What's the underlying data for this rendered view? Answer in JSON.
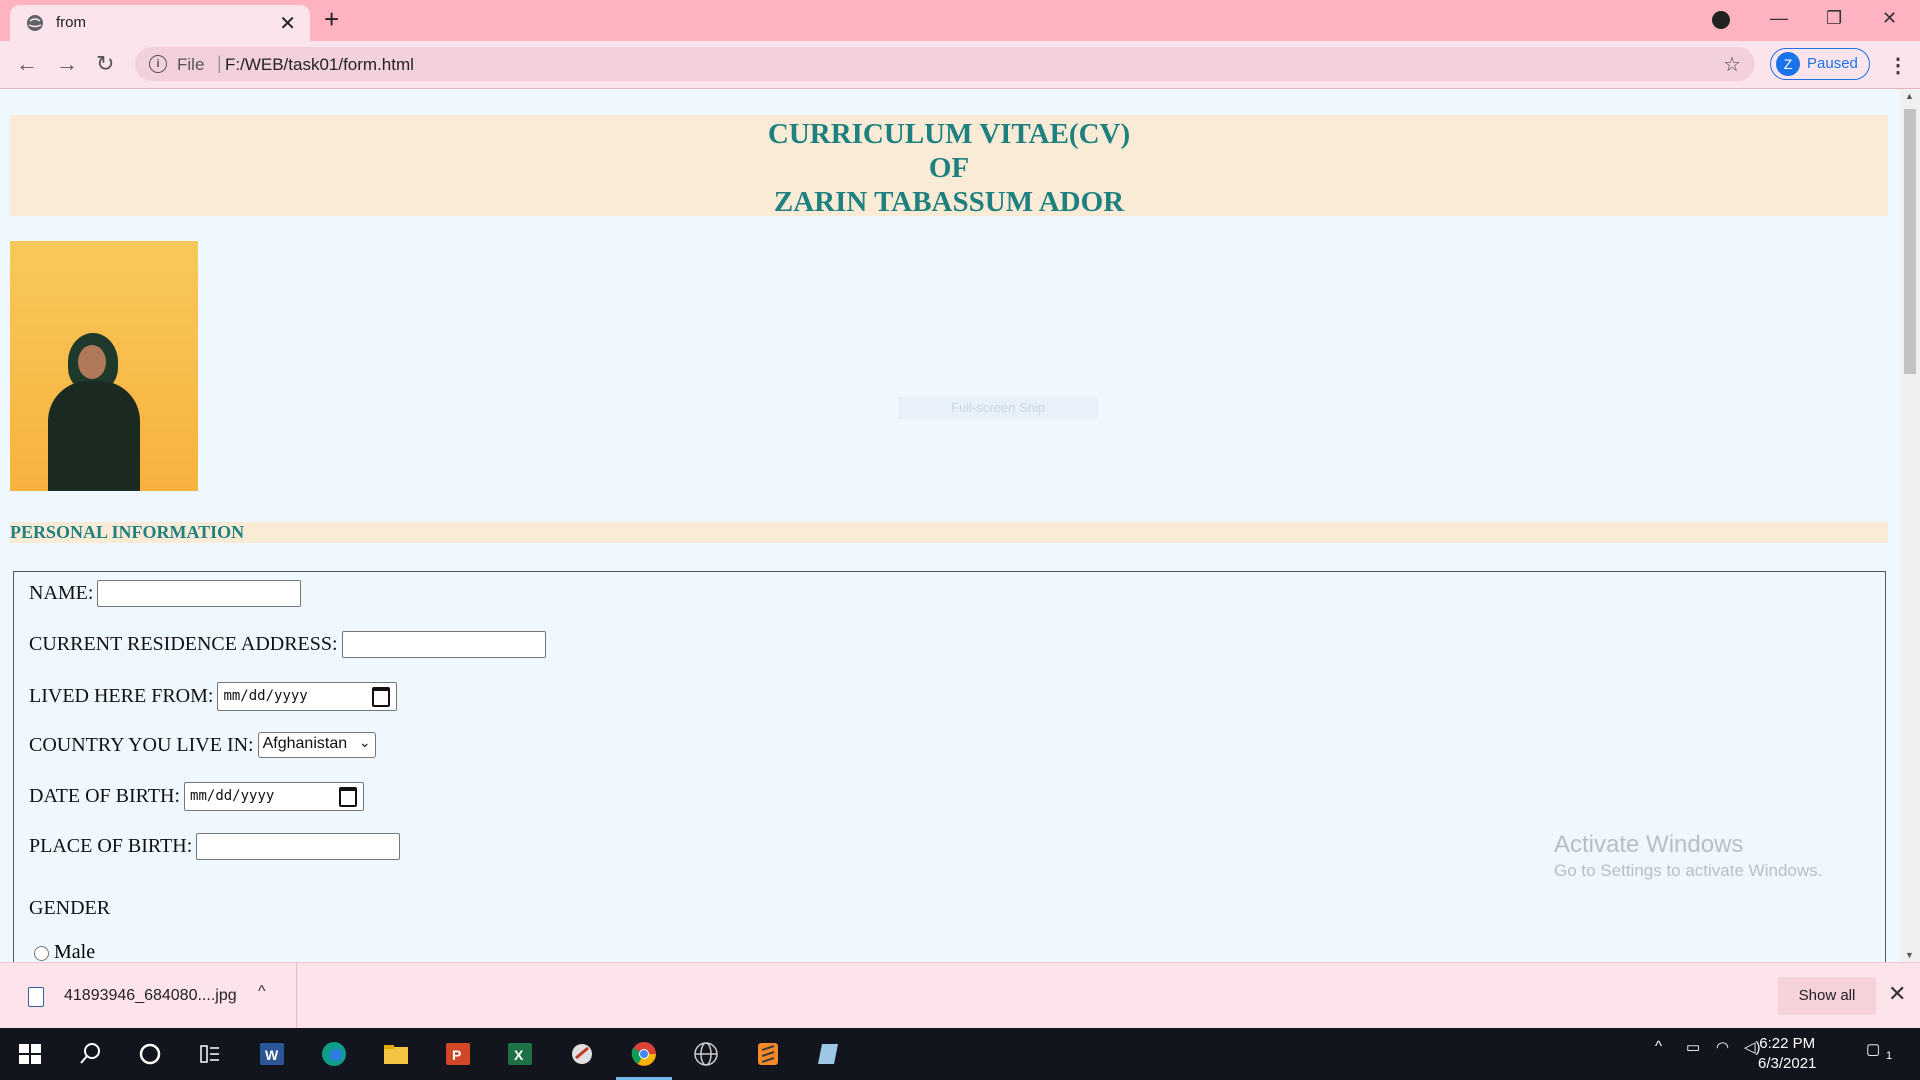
{
  "browser": {
    "tab_title": "from",
    "new_tab": "+",
    "address_file": "File",
    "address_sep": "|",
    "address_url": "F:/WEB/task01/form.html",
    "profile_initial": "Z",
    "profile_status": "Paused"
  },
  "page": {
    "header_line1": "CURRICULUM VITAE(CV)",
    "header_line2": "OF",
    "header_line3": "ZARIN TABASSUM ADOR",
    "snip_text": "Full-screen Snip",
    "section_personal": "PERSONAL INFORMATION",
    "fields": {
      "name_label": "NAME:",
      "address_label": "CURRENT RESIDENCE ADDRESS:",
      "lived_label": "LIVED HERE FROM:",
      "lived_placeholder": "mm/dd/yyyy",
      "country_label": "COUNTRY YOU LIVE IN:",
      "country_value": "Afghanistan",
      "dob_label": "DATE OF BIRTH:",
      "dob_placeholder": "mm/dd/yyyy",
      "pob_label": "PLACE OF BIRTH:",
      "gender_label": "GENDER",
      "gender_male": "Male"
    }
  },
  "watermark": {
    "line1": "Activate Windows",
    "line2": "Go to Settings to activate Windows."
  },
  "downloads": {
    "file_name": "41893946_684080....jpg",
    "show_all": "Show all"
  },
  "taskbar": {
    "time": "6:22 PM",
    "date": "6/3/2021",
    "notif_count": "1"
  }
}
